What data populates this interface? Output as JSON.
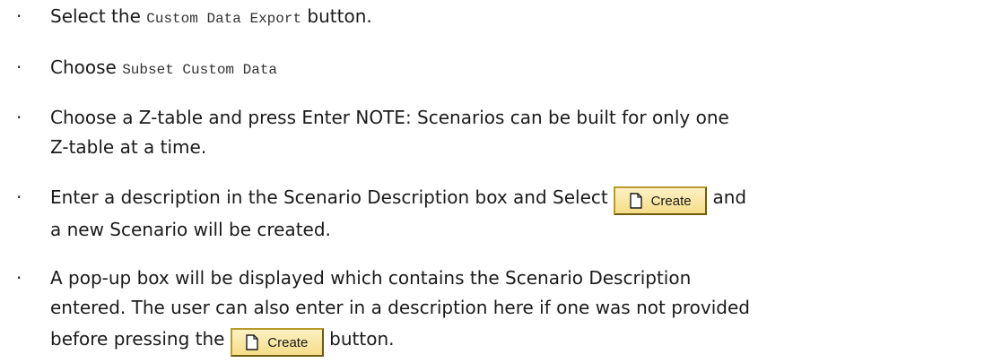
{
  "bullet_glyph": "·",
  "steps": [
    {
      "prefix": "Select the ",
      "code": "Custom Data Export",
      "suffix": " button."
    },
    {
      "prefix": "Choose ",
      "code": "Subset Custom Data"
    },
    {
      "line1": "Choose a Z-table and press Enter NOTE: Scenarios can be built for only one",
      "line2": "Z-table at a time."
    },
    {
      "line1_prefix": "Enter a description in the Scenario Description box and Select ",
      "button_label": "Create",
      "line1_suffix": " and",
      "line2": "a new Scenario will be created."
    },
    {
      "line1": "A pop-up box will be displayed which contains the Scenario Description",
      "line2": "entered. The user can also enter in a description here if one was not provided",
      "line3_prefix": "before pressing the ",
      "button_label": "Create",
      "line3_suffix": " button."
    }
  ],
  "colors": {
    "button_fill": "#f6dd88",
    "button_border": "#b89a2e"
  },
  "icons": {
    "create_button_icon": "document-icon"
  }
}
